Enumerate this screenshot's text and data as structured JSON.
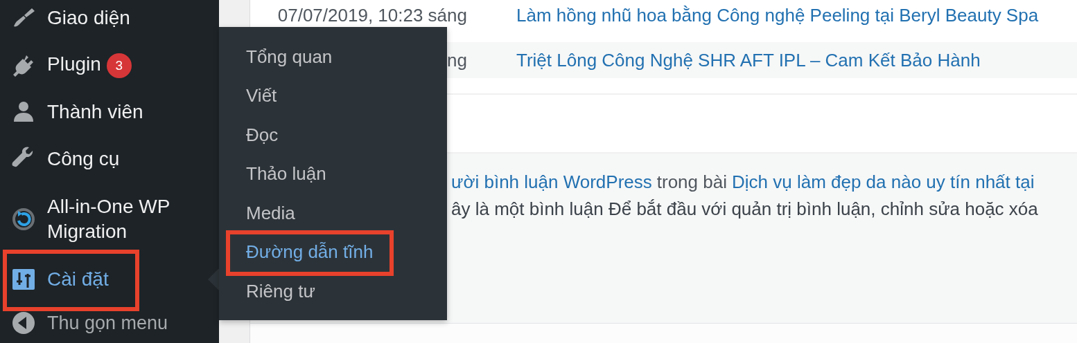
{
  "sidebar": {
    "items": [
      {
        "kind": "appearance",
        "label": "Giao diện",
        "selected": false,
        "annotated": false
      },
      {
        "kind": "plugins",
        "label": "Plugin",
        "badge": "3",
        "selected": false,
        "annotated": false
      },
      {
        "kind": "users",
        "label": "Thành viên",
        "selected": false,
        "annotated": false
      },
      {
        "kind": "tools",
        "label": "Công cụ",
        "selected": false,
        "annotated": false
      },
      {
        "kind": "migration",
        "label": "All-in-One WP Migration",
        "selected": false,
        "annotated": false
      },
      {
        "kind": "settings",
        "label": "Cài đặt",
        "selected": true,
        "annotated": true
      }
    ],
    "collapse": {
      "label": "Thu gọn menu"
    }
  },
  "submenu": {
    "items": [
      {
        "label": "Tổng quan",
        "selected": false,
        "annotated": false
      },
      {
        "label": "Viết",
        "selected": false,
        "annotated": false
      },
      {
        "label": "Đọc",
        "selected": false,
        "annotated": false
      },
      {
        "label": "Thảo luận",
        "selected": false,
        "annotated": false
      },
      {
        "label": "Media",
        "selected": false,
        "annotated": false
      },
      {
        "label": "Đường dẫn tĩnh",
        "selected": true,
        "annotated": true
      },
      {
        "label": "Riêng tư",
        "selected": false,
        "annotated": false
      }
    ]
  },
  "posts": {
    "rows": [
      {
        "date": "07/07/2019, 10:23 sáng",
        "title": "Làm hồng nhũ hoa bằng Công nghệ Peeling tại Beryl Beauty Spa"
      },
      {
        "date": "ng",
        "title": "Triệt Lông Công Nghệ SHR AFT IPL – Cam Kết Bảo Hành"
      }
    ]
  },
  "comment": {
    "lines": [
      {
        "segments": [
          {
            "kind": "link",
            "text": "ười bình luận WordPress"
          },
          {
            "kind": "plain",
            "text": "trong bài"
          },
          {
            "kind": "link",
            "text": "Dịch vụ làm đẹp da nào uy tín nhất tại"
          }
        ]
      },
      {
        "segments": [
          {
            "kind": "plain",
            "text": "ây là một bình luận Để bắt đầu với quản trị bình luận, chỉnh sửa hoặc xóa"
          }
        ]
      }
    ]
  }
}
